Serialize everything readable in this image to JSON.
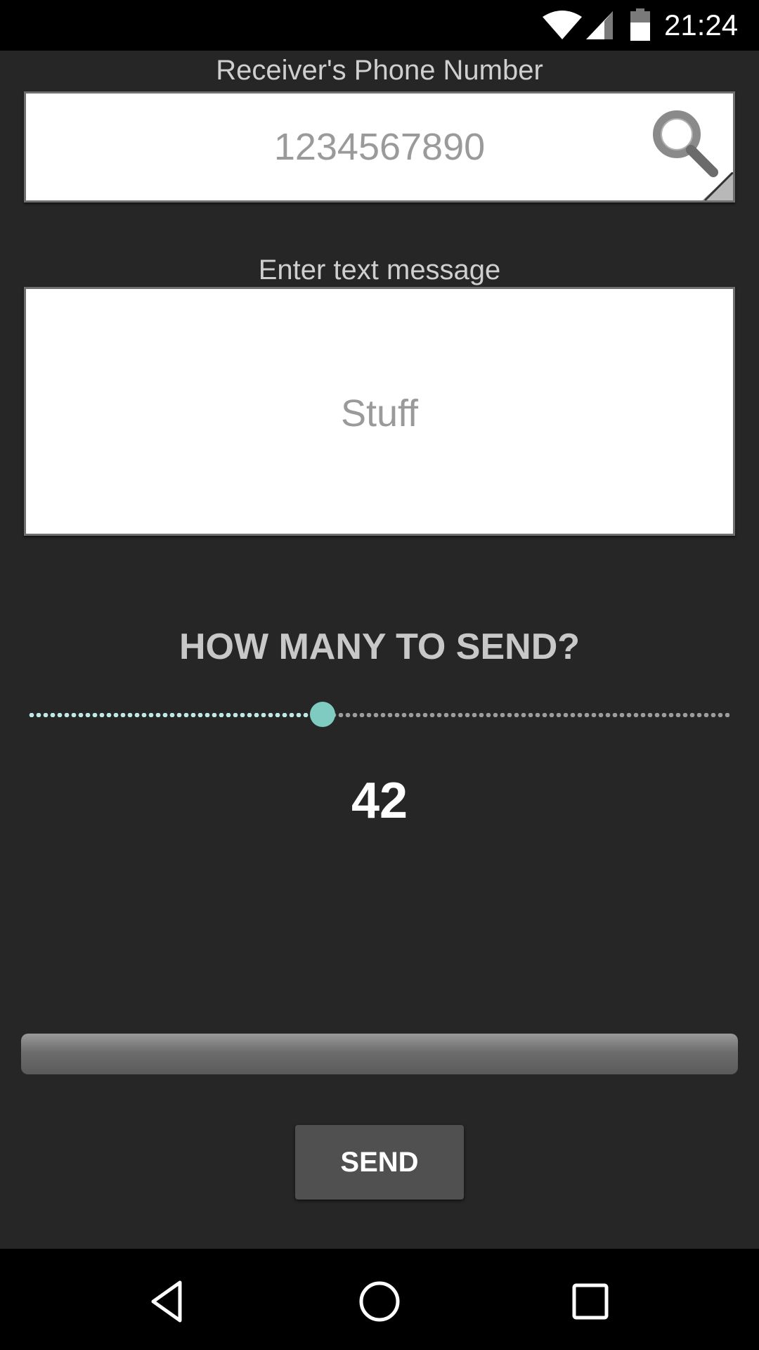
{
  "status_bar": {
    "time": "21:24",
    "icons": [
      "wifi-icon",
      "cell-signal-icon",
      "battery-icon"
    ]
  },
  "form": {
    "phone_label": "Receiver's Phone Number",
    "phone_placeholder": "1234567890",
    "message_label": "Enter text message",
    "message_placeholder": "Stuff"
  },
  "count": {
    "title": "HOW MANY TO SEND?",
    "value": "42",
    "slider_fraction": 0.42,
    "accent_color": "#7fcbc2"
  },
  "progress": {
    "fraction": 0
  },
  "send_button": {
    "label": "SEND"
  },
  "nav_bar": {
    "icons": [
      "back-icon",
      "home-icon",
      "recent-apps-icon"
    ]
  }
}
